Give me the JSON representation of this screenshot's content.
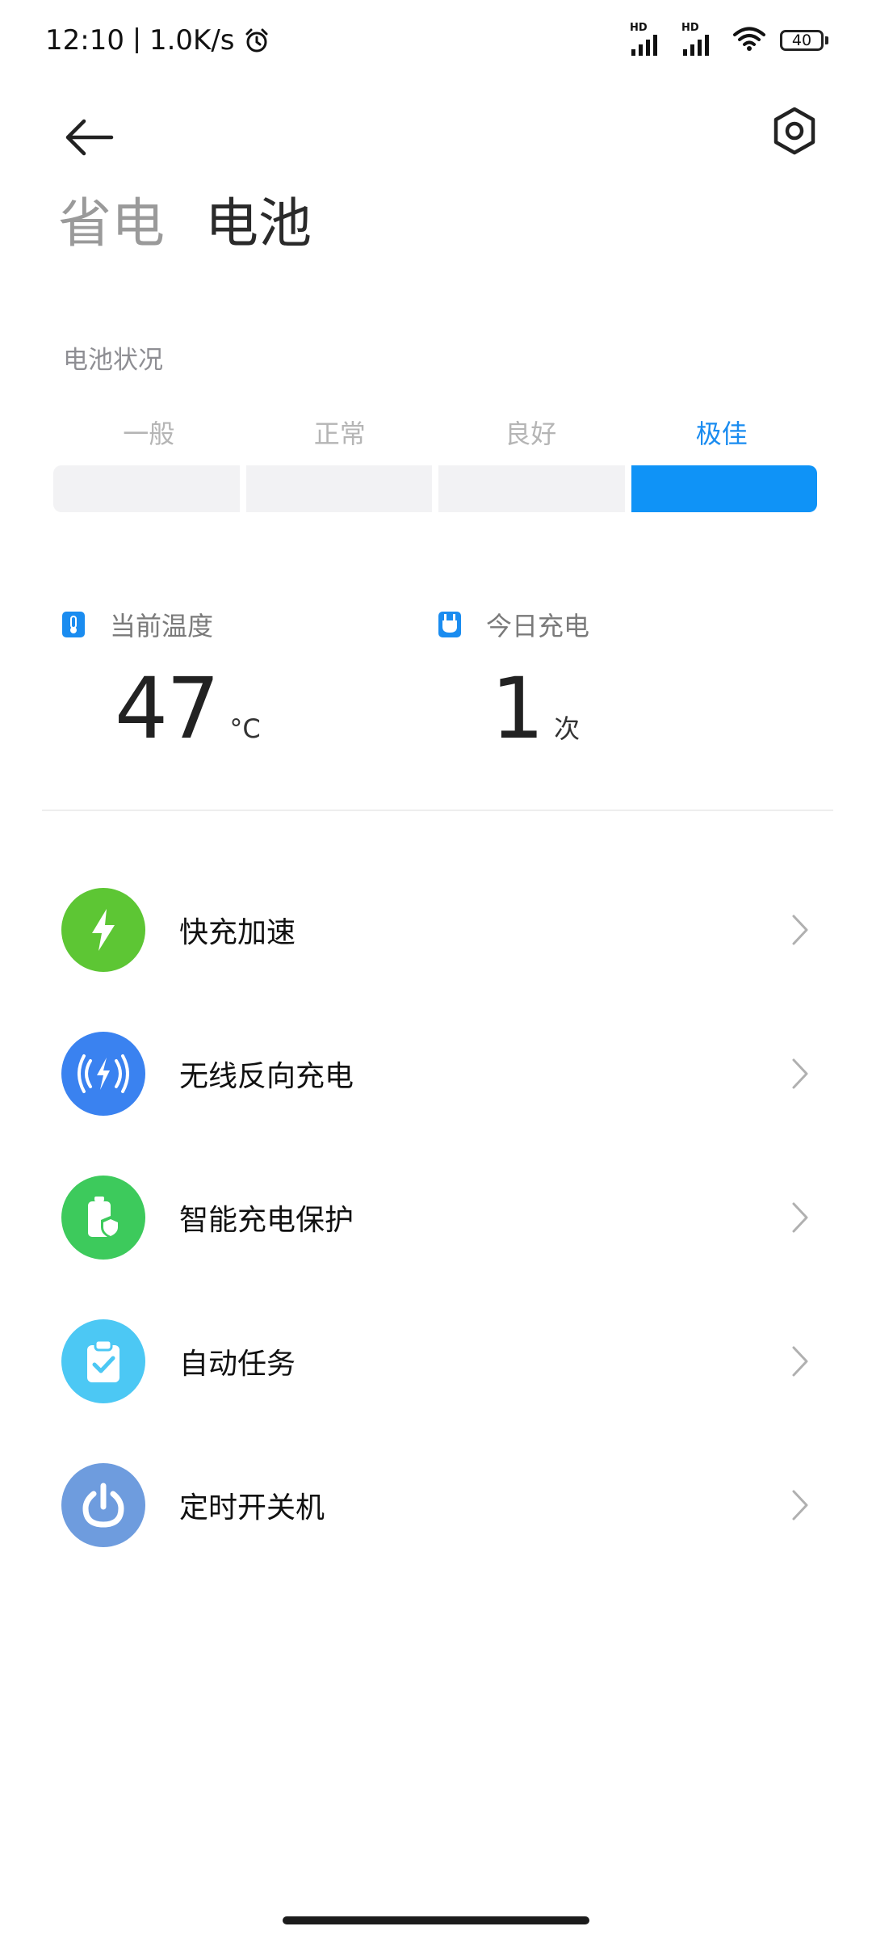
{
  "status_bar": {
    "time": "12:10",
    "net_speed": "1.0K/s",
    "sim1_label": "HD",
    "sim2_label": "HD",
    "battery_level": "40"
  },
  "header": {
    "tabs": [
      {
        "label": "省电",
        "active": false
      },
      {
        "label": "电池",
        "active": true
      }
    ]
  },
  "battery_status": {
    "section_label": "电池状况",
    "levels": [
      "一般",
      "正常",
      "良好",
      "极佳"
    ],
    "active_level": "极佳",
    "accent_color": "#0f93f7"
  },
  "stats": {
    "temperature": {
      "label": "当前温度",
      "value": "47",
      "unit": "°C",
      "icon": "thermometer-icon"
    },
    "charges_today": {
      "label": "今日充电",
      "value": "1",
      "unit": "次",
      "icon": "plug-icon"
    }
  },
  "menu": [
    {
      "label": "快充加速",
      "icon": "lightning-icon",
      "color": "#5dc634"
    },
    {
      "label": "无线反向充电",
      "icon": "wireless-charge-icon",
      "color": "#3a82f0"
    },
    {
      "label": "智能充电保护",
      "icon": "battery-shield-icon",
      "color": "#3dca5c"
    },
    {
      "label": "自动任务",
      "icon": "clipboard-check-icon",
      "color": "#4cc8f4"
    },
    {
      "label": "定时开关机",
      "icon": "power-icon",
      "color": "#6e9cde"
    }
  ]
}
